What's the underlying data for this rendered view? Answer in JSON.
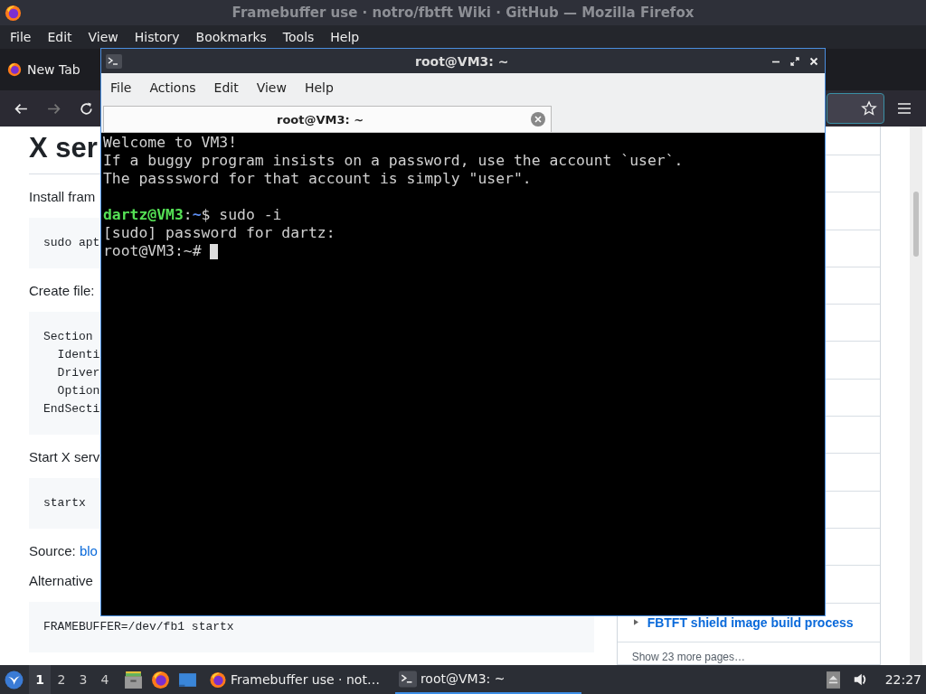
{
  "browser": {
    "title": "Framebuffer use · notro/fbtft Wiki · GitHub — Mozilla Firefox",
    "menu": [
      "File",
      "Edit",
      "View",
      "History",
      "Bookmarks",
      "Tools",
      "Help"
    ],
    "tab": {
      "label": "New Tab"
    },
    "nav": {
      "forward_disabled": true
    },
    "article": [
      {
        "kind": "heading",
        "text": "X ser"
      },
      {
        "kind": "para",
        "text": "Install fram"
      },
      {
        "kind": "code",
        "lines": [
          "sudo apt"
        ]
      },
      {
        "kind": "para",
        "text": "Create file:"
      },
      {
        "kind": "code",
        "lines": [
          "Section",
          "  Identi",
          "  Driver",
          "  Option",
          "EndSecti"
        ]
      },
      {
        "kind": "para",
        "text": "Start X serv"
      },
      {
        "kind": "code",
        "lines": [
          "startx"
        ]
      },
      {
        "kind": "source",
        "text": "Source: ",
        "link": "blo"
      },
      {
        "kind": "para",
        "text": "Alternative"
      },
      {
        "kind": "code",
        "lines": [
          "FRAMEBUFFER=/dev/fb1 startx"
        ]
      }
    ],
    "sidebar": {
      "page_link": "FBTFT shield image build process",
      "more": "Show 23 more pages…"
    }
  },
  "terminal": {
    "title": "root@VM3: ~",
    "menu": [
      "File",
      "Actions",
      "Edit",
      "View",
      "Help"
    ],
    "tabs": [
      {
        "label": "root@VM3: ~",
        "selected": true
      }
    ],
    "lines": [
      {
        "parts": [
          {
            "kind": "plain",
            "text": "Welcome to VM3!"
          }
        ]
      },
      {
        "parts": [
          {
            "kind": "plain",
            "text": "If a buggy program insists on a password, use the account `user`."
          }
        ]
      },
      {
        "parts": [
          {
            "kind": "plain",
            "text": "The passsword for that account is simply \"user\"."
          }
        ]
      },
      {
        "kind": "blank"
      },
      {
        "parts": [
          {
            "kind": "user",
            "text": "dartz@VM3"
          },
          {
            "kind": "plain",
            "text": ":"
          },
          {
            "kind": "path",
            "text": "~"
          },
          {
            "kind": "plain",
            "text": "$ sudo -i"
          }
        ]
      },
      {
        "parts": [
          {
            "kind": "plain",
            "text": "[sudo] password for dartz:"
          }
        ]
      },
      {
        "parts": [
          {
            "kind": "plain",
            "text": "root@VM3:~# "
          }
        ],
        "cursor": true
      }
    ]
  },
  "taskbar": {
    "workspaces": [
      {
        "label": "1",
        "selected": true
      },
      {
        "label": "2",
        "selected": false
      },
      {
        "label": "3",
        "selected": false
      },
      {
        "label": "4",
        "selected": false
      }
    ],
    "tasks": [
      {
        "kind": "firefox",
        "label": "Framebuffer use · not…",
        "selected": false
      },
      {
        "kind": "terminal",
        "label": "root@VM3: ~",
        "selected": true
      }
    ],
    "clock": "22:27"
  }
}
